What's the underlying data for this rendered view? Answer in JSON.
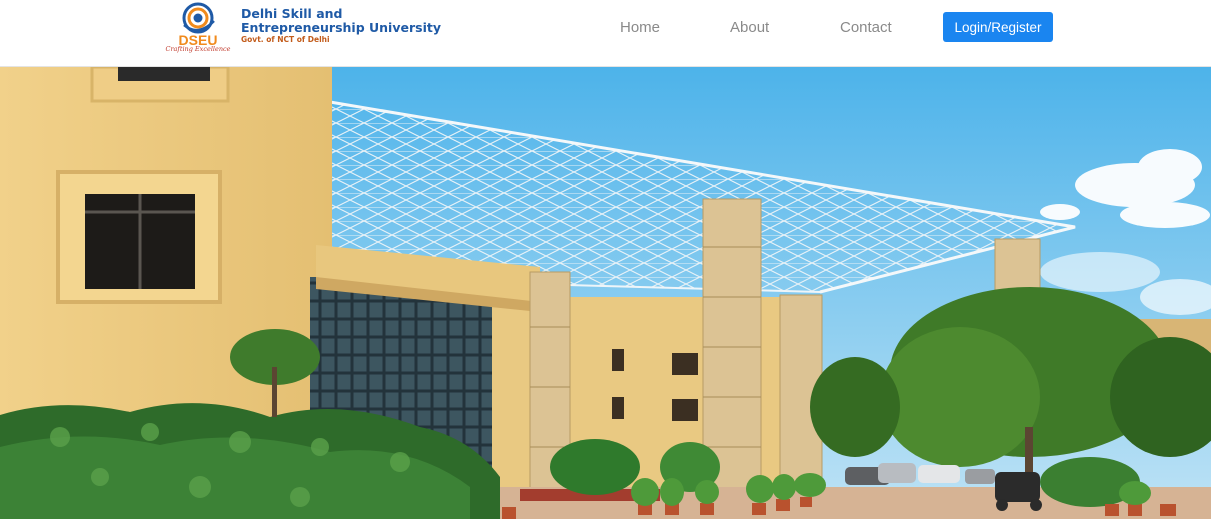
{
  "brand": {
    "logo_text": "DSEU",
    "logo_tagline": "Crafting Excellence",
    "name_line1": "Delhi Skill and",
    "name_line2": "Entrepreneurship University",
    "name_line3": "Govt. of NCT of Delhi",
    "primary_color": "#1f5aa6",
    "accent_color": "#c25b1a"
  },
  "nav": {
    "items": [
      {
        "label": "Home",
        "icon": "none"
      },
      {
        "label": "About",
        "icon": "none"
      },
      {
        "label": "Contact",
        "icon": "none"
      }
    ],
    "login_label": "Login/Register",
    "button_color": "#1a85f0"
  },
  "hero": {
    "image": "campus-building-photo"
  }
}
